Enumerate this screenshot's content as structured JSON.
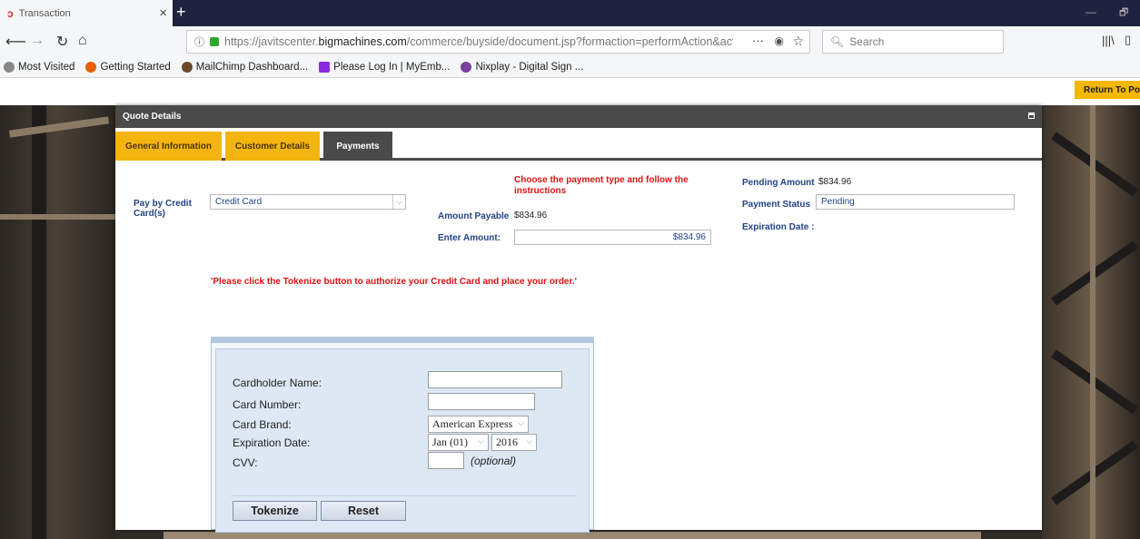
{
  "browser": {
    "tab_title": "Transaction",
    "tab_icon": "ↄ",
    "close_glyph": "×",
    "new_tab_glyph": "+",
    "url_prefix": "https://javitscenter.",
    "url_host": "bigmachines.com",
    "url_rest": "/commerce/buyside/document.jsp?formaction=performAction&actio",
    "url_more": "···",
    "search_placeholder": "Search",
    "bookmarks": [
      {
        "label": "Most Visited",
        "color": "#888888"
      },
      {
        "label": "Getting Started",
        "color": "#e66000"
      },
      {
        "label": "MailChimp Dashboard...",
        "color": "#6b4a2a"
      },
      {
        "label": "Please Log In | MyEmb...",
        "color": "#8a2be2"
      },
      {
        "label": "Nixplay - Digital Sign ...",
        "color": "#7a3fa0"
      }
    ]
  },
  "page": {
    "return_label": "Return To Port",
    "panel_title": "Quote Details",
    "tabs": [
      {
        "label": "General Information"
      },
      {
        "label": "Customer Details"
      },
      {
        "label": "Payments"
      }
    ],
    "pay_by_label": "Pay by Credit Card(s)",
    "payment_type_value": "Credit Card",
    "instructions_line1": "Choose the payment type and follow the",
    "instructions_line2": "instructions",
    "amount_payable_label": "Amount Payable",
    "amount_payable_value": "$834.96",
    "enter_amount_label": "Enter Amount:",
    "enter_amount_value": "$834.96",
    "pending_amount_label": "Pending Amount",
    "pending_amount_value": "$834.96",
    "payment_status_label": "Payment Status",
    "payment_status_value": "Pending",
    "expiration_label": "Expiration Date :",
    "tokenize_notice": "'Please click the Tokenize button to authorize your Credit Card and place your order.'"
  },
  "card_form": {
    "cardholder_label": "Cardholder Name:",
    "card_number_label": "Card Number:",
    "card_brand_label": "Card Brand:",
    "card_brand_value": "American Express",
    "expiration_label": "Expiration Date:",
    "exp_month_value": "Jan (01)",
    "exp_year_value": "2016",
    "cvv_label": "CVV:",
    "optional_text": "(optional)",
    "tokenize_button": "Tokenize",
    "reset_button": "Reset"
  },
  "colors": {
    "tab_yellow": "#f4b510",
    "tab_active": "#4a4a4a",
    "label_blue": "#224488",
    "alert_red": "#e01010"
  }
}
